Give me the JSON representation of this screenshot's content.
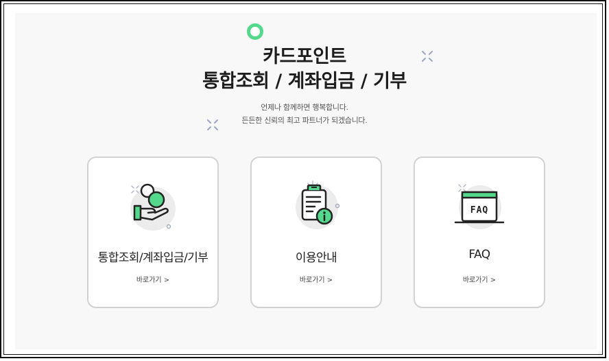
{
  "header": {
    "title_line1": "카드포인트",
    "title_line2": "통합조회 / 계좌입금 / 기부",
    "subtitle_line1": "언제나 함께하면 행복합니다.",
    "subtitle_line2": "든든한 신뢰의 최고 파트너가 되겠습니다."
  },
  "cards": [
    {
      "icon": "coin-hand-icon",
      "label": "통합조회/계좌입금/기부",
      "link": "바로가기 >"
    },
    {
      "icon": "clipboard-info-icon",
      "label": "이용안내",
      "link": "바로가기 >"
    },
    {
      "icon": "faq-monitor-icon",
      "label": "FAQ",
      "link": "바로가기 >",
      "icon_text": "FAQ"
    }
  ],
  "colors": {
    "accent": "#54d98c",
    "card_border": "#d2d2d2",
    "panel_bg": "#f8f8f8"
  }
}
